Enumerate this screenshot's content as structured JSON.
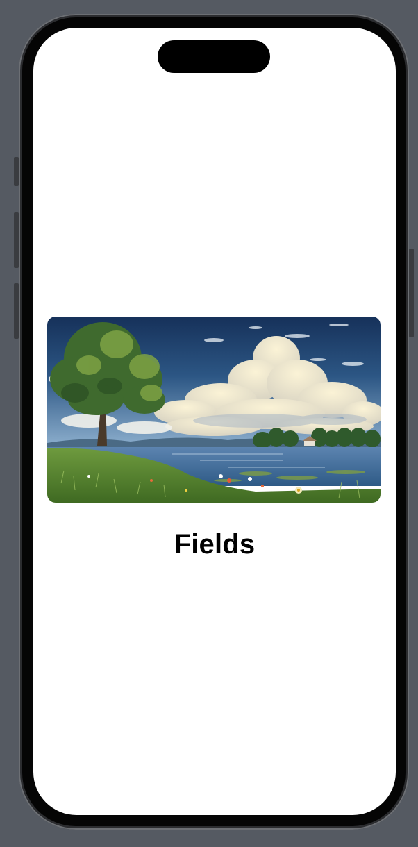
{
  "screen": {
    "title": "Fields"
  },
  "hero_image": {
    "icon": "landscape-lake-tree-image"
  }
}
